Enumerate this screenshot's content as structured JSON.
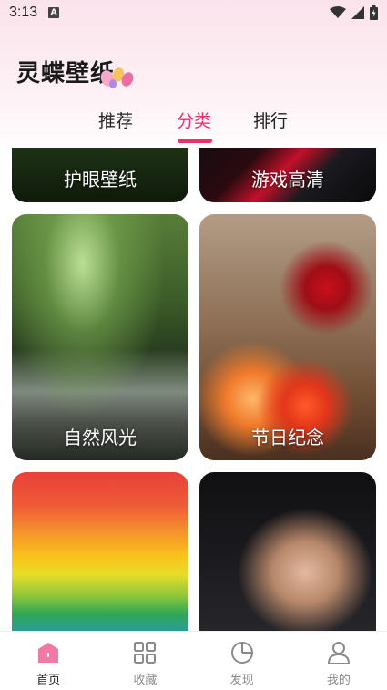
{
  "status_bar": {
    "time": "3:13",
    "notification_glyph": "A"
  },
  "app": {
    "title": "灵蝶壁纸"
  },
  "tabs": [
    {
      "label": "推荐",
      "active": false
    },
    {
      "label": "分类",
      "active": true
    },
    {
      "label": "排行",
      "active": false
    }
  ],
  "categories": [
    {
      "label": "护眼壁纸"
    },
    {
      "label": "游戏高清"
    },
    {
      "label": "自然风光"
    },
    {
      "label": "节日纪念"
    },
    {
      "label": ""
    },
    {
      "label": ""
    }
  ],
  "bottom_nav": [
    {
      "label": "首页",
      "icon": "home-icon",
      "active": true
    },
    {
      "label": "收藏",
      "icon": "grid-icon",
      "active": false
    },
    {
      "label": "发现",
      "icon": "pie-chart-icon",
      "active": false
    },
    {
      "label": "我的",
      "icon": "user-icon",
      "active": false
    }
  ],
  "colors": {
    "accent": "#e8336d",
    "text": "#222222",
    "muted": "#8a8a8a"
  }
}
